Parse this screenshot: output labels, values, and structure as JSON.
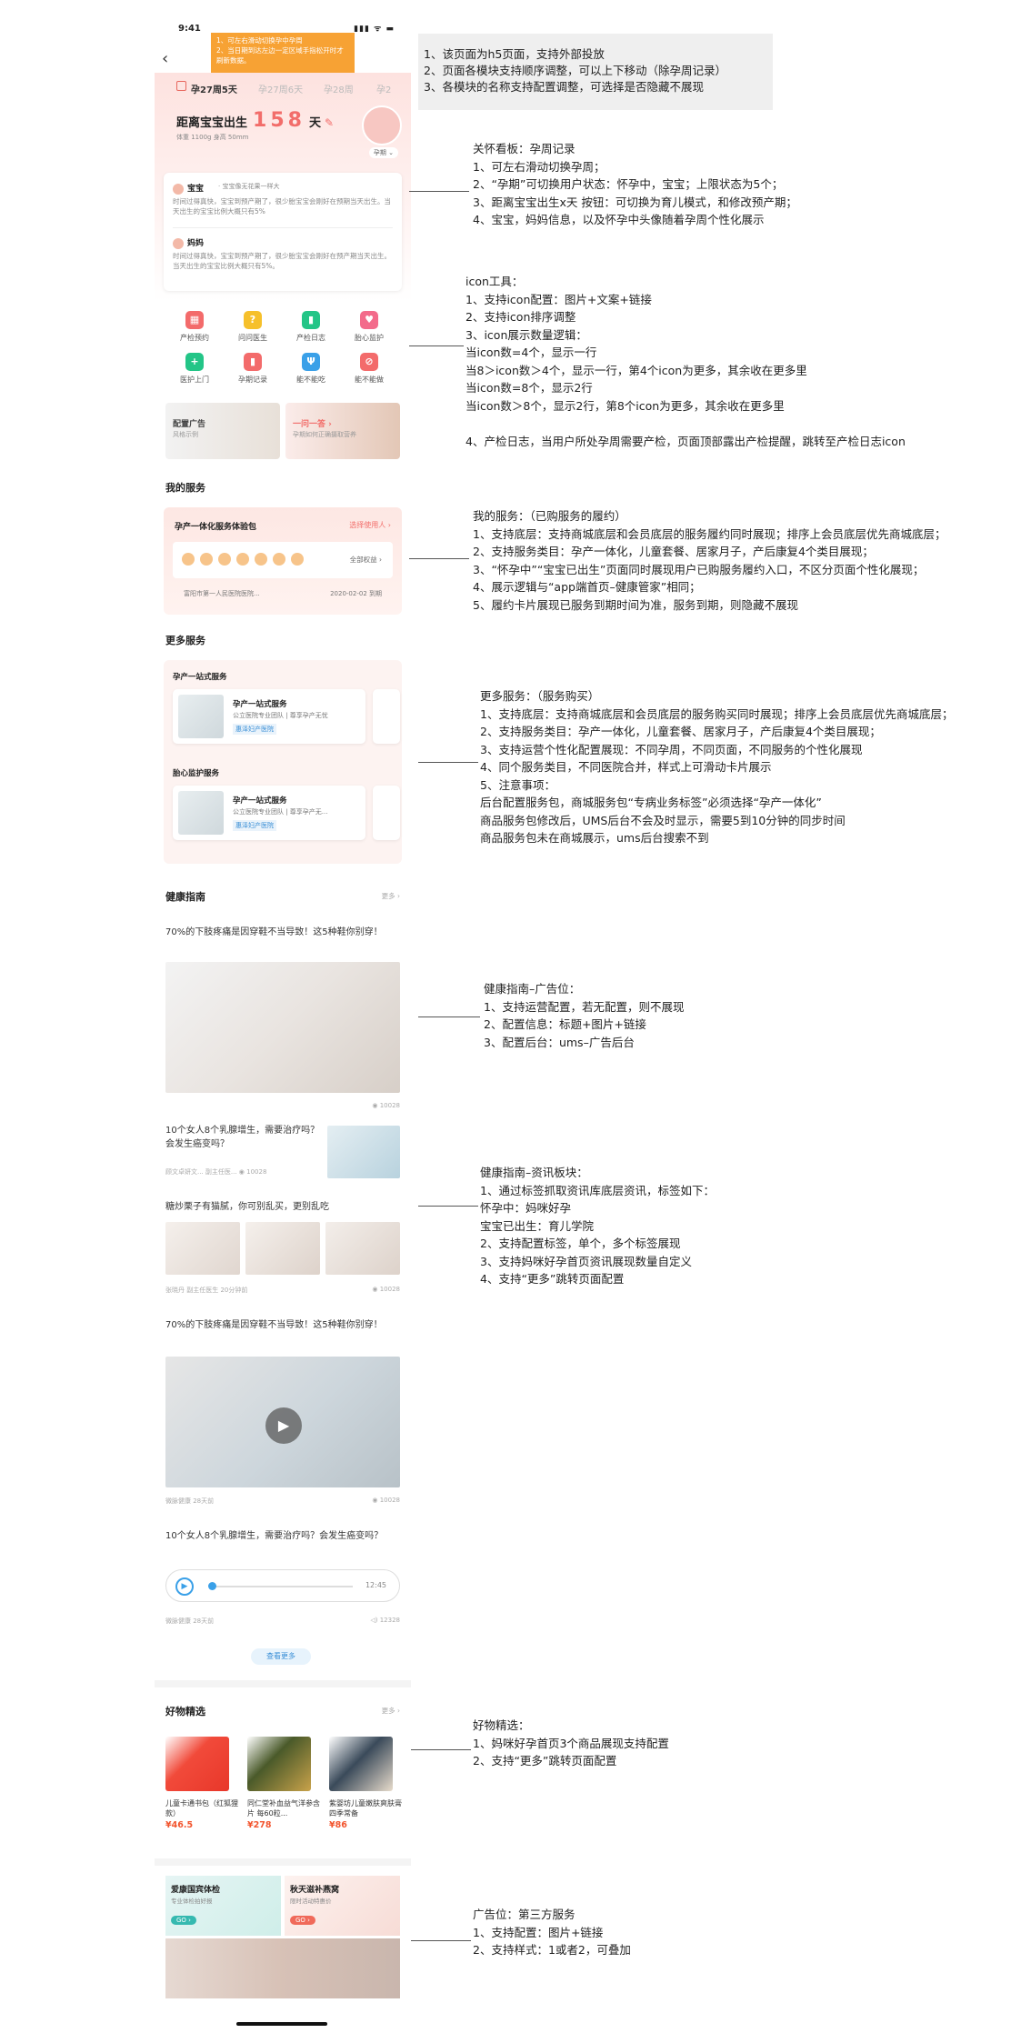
{
  "status_time": "9:41",
  "status_icons": "▮▮▮ ᯤ ▬",
  "tip_note": [
    "1、可左右滑动切换孕中孕周",
    "2、当日期到达左边一定区域手指松开时才刷新数据。"
  ],
  "care": {
    "weeks": [
      "孕27周5天",
      "孕27周6天",
      "孕28周",
      "孕2"
    ],
    "countdown_label": "距离宝宝出生",
    "countdown_value": "158",
    "countdown_unit": "天",
    "edit_icon": "✎",
    "baby_stats": "体重 1100g    身高 50mm",
    "status_tag": "孕期 ⌄",
    "baby_name": "宝宝",
    "baby_quote": "· 宝宝像无花果一样大",
    "baby_text": "时间过得真快，宝宝到预产期了，很少胎宝宝会刚好在预期当天出生。当天出生的宝宝比例大概只有5%",
    "mom_name": "妈妈",
    "mom_text": "时间过得真快，宝宝到预产期了，很少胎宝宝会刚好在预产期当天出生。当天出生的宝宝比例大概只有5%。"
  },
  "icons": [
    {
      "label": "产检预约",
      "glyph": "▦",
      "color": "#f36b6b"
    },
    {
      "label": "问问医生",
      "glyph": "?",
      "color": "#f6c02b"
    },
    {
      "label": "产检日志",
      "glyph": "▮",
      "color": "#23c587"
    },
    {
      "label": "胎心监护",
      "glyph": "♥",
      "color": "#f36b8b"
    },
    {
      "label": "医护上门",
      "glyph": "+",
      "color": "#23c587"
    },
    {
      "label": "孕期记录",
      "glyph": "▮",
      "color": "#f36b6b"
    },
    {
      "label": "能不能吃",
      "glyph": "Ψ",
      "color": "#3aa0e8"
    },
    {
      "label": "能不能做",
      "glyph": "⊘",
      "color": "#f36b6b"
    }
  ],
  "promo": {
    "left_title": "配置广告",
    "left_sub": "风格示例",
    "right_title": "一问一答 ›",
    "right_sub": "孕期如何正确摄取营养"
  },
  "my_service": {
    "title": "我的服务",
    "pkg_name": "孕产一体化服务体验包",
    "use_label": "选择使用人 ›",
    "all_label": "全部权益 ›",
    "hospital": "富阳市第一人民医院医院...",
    "expire": "2020-02-02 到期"
  },
  "more_service": {
    "title": "更多服务",
    "group1": "孕产一站式服务",
    "group2": "胎心监护服务",
    "card_name": "孕产一站式服务",
    "card_desc": "公立医院专业团队 | 尊享孕产无忧",
    "card_desc2": "公立医院专业团队 | 尊享孕产无...",
    "card_hosp": "惠泽妇产医院"
  },
  "health": {
    "title": "健康指南",
    "more": "更多 ›",
    "a1_title": "70%的下肢疼痛是因穿鞋不当导致！这5种鞋你别穿！",
    "a1_views": "◉ 10028",
    "a2_title": "10个女人8个乳腺增生，需要治疗吗？会发生癌变吗？",
    "a2_meta": "顾文卓妍文...  副主任医...  ◉ 10028",
    "a3_title": "糖炒栗子有猫腻，你可别乱买，更别乱吃",
    "a3_meta": "张晓丹  副主任医生    20分钟前",
    "a3_views": "◉ 10028",
    "a4_title": "70%的下肢疼痛是因穿鞋不当导致！这5种鞋你别穿！",
    "a4_meta": "微脉健康    28天前",
    "a4_views": "◉ 10028",
    "a5_title": "10个女人8个乳腺增生，需要治疗吗？会发生癌变吗？",
    "a5_duration": "12:45",
    "a5_meta": "微脉健康    28天前",
    "a5_views": "◁) 12328",
    "load_more": "查看更多"
  },
  "goods": {
    "title": "好物精选",
    "more": "更多 ›",
    "items": [
      {
        "name": "儿童卡通书包（红狐狸款）",
        "price": "¥46.5"
      },
      {
        "name": "同仁堂补血益气洋参含片 每60粒...",
        "price": "¥278"
      },
      {
        "name": "紫婴坊儿童嫩肤爽肤膏 四季常备",
        "price": "¥86"
      }
    ]
  },
  "ads": {
    "left_title": "爱康国宾体检",
    "left_sub": "专业体检拍好报",
    "left_go": "GO ›",
    "right_title": "秋天滋补燕窝",
    "right_sub": "限时活动特惠价",
    "right_go": "GO ›"
  },
  "notes": {
    "top": [
      "1、该页面为h5页面，支持外部投放",
      "2、页面各模块支持顺序调整，可以上下移动（除孕周记录）",
      "3、各模块的名称支持配置调整，可选择是否隐藏不展现"
    ],
    "care": [
      "关怀看板：孕周记录",
      "1、可左右滑动切换孕周；",
      "2、“孕期”可切换用户状态：怀孕中，宝宝；上限状态为5个；",
      "3、距离宝宝出生x天 按钮：可切换为育儿模式，和修改预产期；",
      "4、宝宝，妈妈信息，以及怀孕中头像随着孕周个性化展示"
    ],
    "icon": [
      "icon工具：",
      "1、支持icon配置：图片+文案+链接",
      "2、支持icon排序调整",
      "3、icon展示数量逻辑：",
      "当icon数=4个，显示一行",
      "当8＞icon数＞4个，显示一行，第4个icon为更多，其余收在更多里",
      "当icon数=8个，显示2行",
      "当icon数＞8个，显示2行，第8个icon为更多，其余收在更多里",
      "",
      "4、产检日志，当用户所处孕周需要产检，页面顶部露出产检提醒，跳转至产检日志icon"
    ],
    "my_service": [
      "我的服务：（已购服务的履约）",
      "1、支持底层：支持商城底层和会员底层的服务履约同时展现；排序上会员底层优先商城底层；",
      "2、支持服务类目：孕产一体化，儿童套餐、居家月子，产后康复4个类目展现；",
      "3、“怀孕中”“宝宝已出生”页面同时展现用户已购服务履约入口，不区分页面个性化展现；",
      "4、展示逻辑与“app端首页–健康管家”相同；",
      "5、履约卡片展现已服务到期时间为准，服务到期，则隐藏不展现"
    ],
    "more_service": [
      "更多服务：（服务购买）",
      "1、支持底层：支持商城底层和会员底层的服务购买同时展现；排序上会员底层优先商城底层；",
      "2、支持服务类目：孕产一体化，儿童套餐、居家月子，产后康复4个类目展现；",
      "3、支持运营个性化配置展现：不同孕周，不同页面，不同服务的个性化展现",
      "4、同个服务类目，不同医院合并，样式上可滑动卡片展示",
      "5、注意事项：",
      "后台配置服务包，商城服务包“专病业务标签”必须选择“孕产一体化”",
      "商品服务包修改后，UMS后台不会及时显示，需要5到10分钟的同步时间",
      "商品服务包未在商城展示，ums后台搜索不到"
    ],
    "health_ad": [
      "健康指南–广告位：",
      "1、支持运营配置，若无配置，则不展现",
      "2、配置信息：标题+图片+链接",
      "3、配置后台：ums–广告后台"
    ],
    "health_info": [
      "健康指南–资讯板块：",
      "1、通过标签抓取资讯库底层资讯，标签如下：",
      "怀孕中：妈咪好孕",
      "宝宝已出生：育儿学院",
      "2、支持配置标签，单个，多个标签展现",
      "3、支持妈咪好孕首页资讯展现数量自定义",
      "4、支持“更多”跳转页面配置"
    ],
    "goods": [
      "好物精选：",
      "1、妈咪好孕首页3个商品展现支持配置",
      "2、支持“更多”跳转页面配置"
    ],
    "ad": [
      "广告位：第三方服务",
      "1、支持配置：图片+链接",
      "2、支持样式：1或者2，可叠加"
    ]
  }
}
